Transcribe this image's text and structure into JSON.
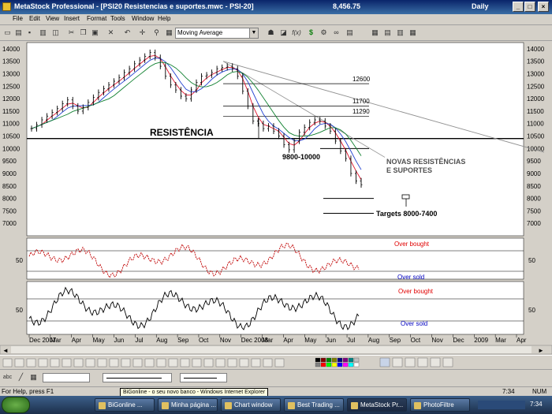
{
  "window": {
    "title": "MetaStock Professional - [PSI20  Resistencias e suportes.mwc - PSI-20]",
    "price": "8,456.75",
    "periodicity": "Daily"
  },
  "menu": [
    "File",
    "Edit",
    "View",
    "Insert",
    "Format",
    "Tools",
    "Window",
    "Help"
  ],
  "toolbar": {
    "indicator_select": "Moving Average",
    "dollar": "$",
    "fx": "f(x)"
  },
  "price_axis": [
    "14000",
    "13500",
    "13000",
    "12500",
    "12000",
    "11500",
    "11000",
    "10500",
    "10000",
    "9500",
    "9000",
    "8500",
    "8000",
    "7500",
    "7000"
  ],
  "osc_axis": {
    "upper": "50",
    "lower": "50"
  },
  "annotations": {
    "resist": "RESISTÊNCIA",
    "support_zone": "9800-10000",
    "new_levels": "NOVAS RESISTÊNCIAS\nE SUPORTES",
    "targets": "Targets 8000-7400",
    "lvl_12600": "12600",
    "lvl_11700": "11700",
    "lvl_11290": "11290",
    "overbought1": "Over bought",
    "oversold1": "Over sold",
    "overbought2": "Over bought",
    "oversold2": "Over sold"
  },
  "date_axis": [
    "Dec 2007",
    "Mar",
    "Apr",
    "May",
    "Jun",
    "Jul",
    "Aug",
    "Sep",
    "Oct",
    "Nov",
    "Dec 2008",
    "Mar",
    "Apr",
    "May",
    "Jun",
    "Jul",
    "Aug",
    "Sep",
    "Oct",
    "Nov",
    "Dec",
    "2009",
    "Mar",
    "Apr"
  ],
  "colors": {
    "candle": "#000000",
    "ma_red": "#e0102a",
    "ma_blue": "#2040d0",
    "ma_green": "#108030",
    "ma_gray": "#808080",
    "overbought_text": "#e00000",
    "oversold_text": "#0000c0",
    "osc_red": "#c00000"
  },
  "status": {
    "help": "For Help, press F1",
    "time": "7:34",
    "num": "NUM"
  },
  "tooltip": "BiGonline - o seu novo banco - Windows Internet Explorer",
  "taskbar": {
    "tasks": [
      "BiGonline ...",
      "Minha página ...",
      "Chart window",
      "Best Trading ...",
      "MetaStock Pr...",
      "PhotoFiltre"
    ],
    "clock": "7:34"
  },
  "chart_data": {
    "type": "candlestick",
    "price_range": [
      6500,
      14250
    ],
    "resistance_level": 10400,
    "levels": [
      12600,
      11700,
      11290
    ],
    "support_zone": [
      9800,
      10000
    ],
    "targets": [
      8000,
      7400
    ],
    "trend_line": {
      "from": 13500,
      "to": 9850
    },
    "series": [
      {
        "name": "",
        "values": [
          10800,
          10950,
          11150,
          11300,
          11450,
          11600,
          11800,
          11950,
          11700,
          11500,
          11650,
          11850,
          12050,
          12250,
          12400,
          12550,
          12700,
          12850,
          13050,
          13200,
          13400,
          13550,
          13700,
          13850,
          13650,
          13300,
          12900,
          12550,
          12350,
          12100,
          12000,
          12350,
          12650,
          12900,
          12950,
          13050,
          13200,
          13250,
          13300,
          13200,
          12900,
          12300,
          11700,
          11100,
          11000,
          10800,
          10900,
          10700,
          10500,
          10150,
          9950,
          10300,
          10650,
          10850,
          11050,
          11150,
          11100,
          10900,
          10700,
          10300,
          9900,
          9600,
          9000,
          8700,
          8550
        ]
      }
    ]
  }
}
